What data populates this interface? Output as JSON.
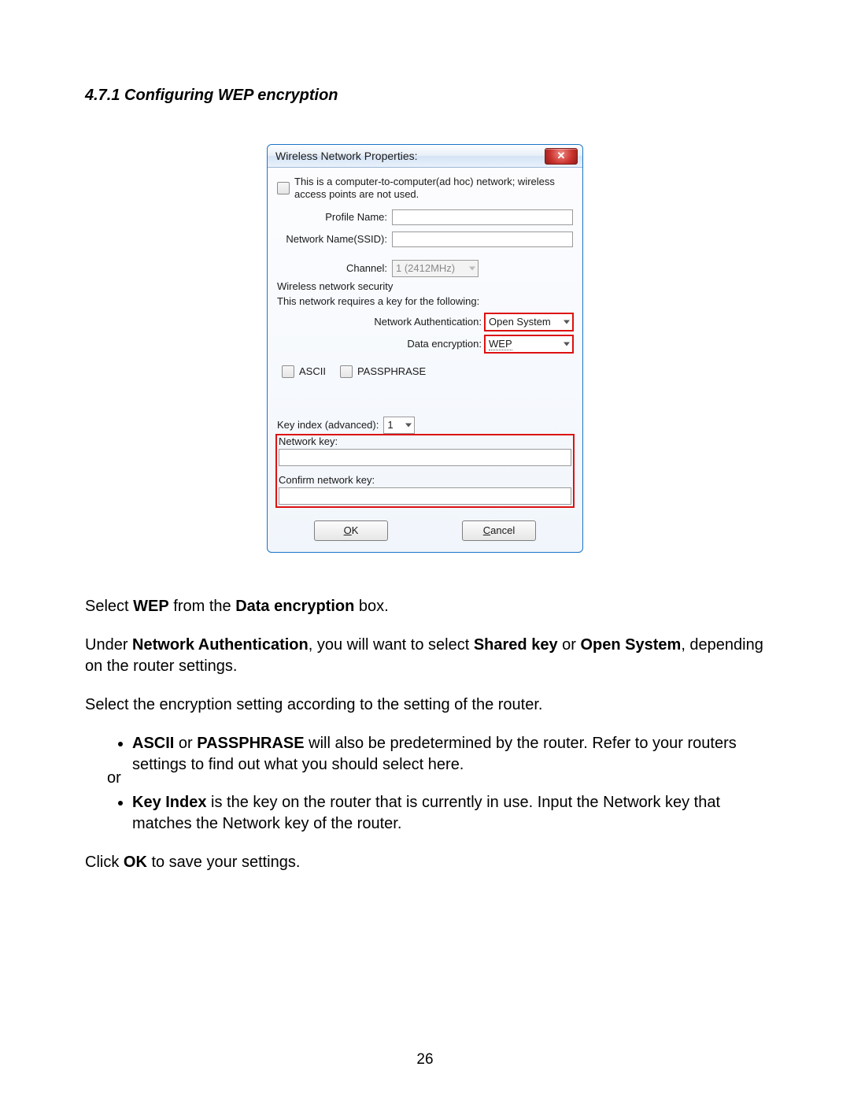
{
  "heading": "4.7.1 Configuring WEP encryption",
  "dialog": {
    "title": "Wireless Network Properties:",
    "close_glyph": "✕",
    "adhoc": "This is a computer-to-computer(ad hoc) network; wireless access points are not used.",
    "profile_label": "Profile Name:",
    "ssid_label": "Network Name(SSID):",
    "channel_label": "Channel:",
    "channel_value": "1 (2412MHz)",
    "security_heading": "Wireless network security",
    "security_sub": "This network requires a key for the following:",
    "auth_label": "Network Authentication:",
    "auth_value": "Open System",
    "enc_label": "Data encryption:",
    "enc_value": "WEP",
    "ascii_label": "ASCII",
    "pass_label": "PASSPHRASE",
    "keyidx_label": "Key index (advanced):",
    "keyidx_value": "1",
    "netkey_label": "Network key:",
    "confirm_label": "Confirm network key:",
    "ok_o": "O",
    "ok_k": "K",
    "cancel_c": "C",
    "cancel_rest": "ancel"
  },
  "body": {
    "p1a": "Select ",
    "p1b": "WEP",
    "p1c": " from the ",
    "p1d": "Data encryption",
    "p1e": " box.",
    "p2a": "Under ",
    "p2b": "Network Authentication",
    "p2c": ", you will want to select ",
    "p2d": "Shared key",
    "p2e": " or ",
    "p2f": "Open System",
    "p2g": ", depending on the router settings.",
    "p3": "Select the encryption setting according to the setting of the router.",
    "li1a": "ASCII",
    "li1b": "  or  ",
    "li1c": "PASSPHRASE",
    "li1d": " will also be predetermined by the router. Refer to your routers settings to find out what you should select here.",
    "or": "or",
    "li2a": "Key Index",
    "li2b": " is the key on the router that is currently in use. Input the Network key that matches the Network key of the router.",
    "p4a": "Click ",
    "p4b": "OK",
    "p4c": " to save your settings."
  },
  "page_number": "26"
}
